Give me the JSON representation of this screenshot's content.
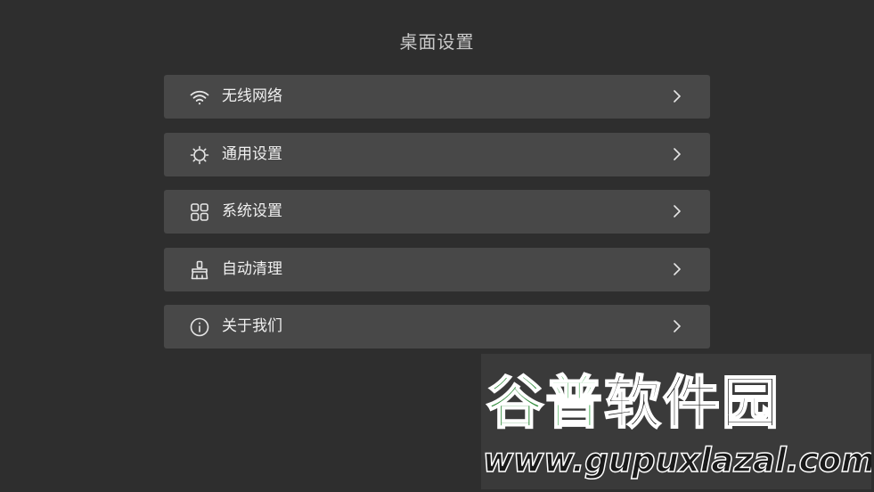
{
  "header": {
    "title": "桌面设置"
  },
  "menu": {
    "items": [
      {
        "label": "无线网络",
        "icon": "wifi-icon"
      },
      {
        "label": "通用设置",
        "icon": "sun-icon"
      },
      {
        "label": "系统设置",
        "icon": "apps-grid-icon"
      },
      {
        "label": "自动清理",
        "icon": "broom-icon"
      },
      {
        "label": "关于我们",
        "icon": "info-icon"
      }
    ],
    "chevron_icon": "chevron-right-icon"
  },
  "watermark": {
    "text_cn": "谷普软件园",
    "text_cn_parts": [
      "谷",
      "普",
      "软件园"
    ],
    "url": "www.gupuxlazal.com"
  },
  "colors": {
    "background": "#2e2e2e",
    "item_background": "#484848",
    "title_text": "#c9c9c9",
    "item_text": "#f0f0f0",
    "watermark_green": "#2f8a3a"
  }
}
